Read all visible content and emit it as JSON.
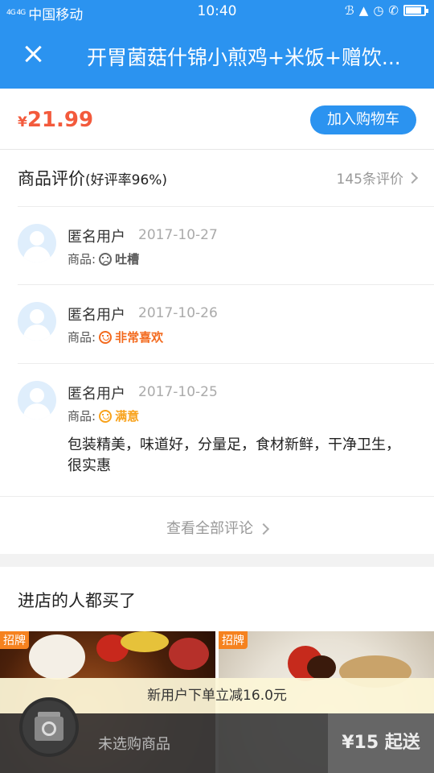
{
  "status_bar": {
    "signal": "4G 4G",
    "carrier": "中国移动",
    "time": "10:40",
    "battery_level": 0.85
  },
  "header": {
    "title": "开胃菌菇什锦小煎鸡+米饭+赠饮..."
  },
  "product": {
    "currency": "¥",
    "price": "21.99",
    "add_cart_label": "加入购物车"
  },
  "reviews": {
    "title": "商品评价",
    "rate": "(好评率96%)",
    "count": "145条评价",
    "items": [
      {
        "name": "匿名用户",
        "date": "2017-10-27",
        "goods_label": "商品:",
        "sentiment": "吐槽",
        "text": ""
      },
      {
        "name": "匿名用户",
        "date": "2017-10-26",
        "goods_label": "商品:",
        "sentiment": "非常喜欢",
        "text": ""
      },
      {
        "name": "匿名用户",
        "date": "2017-10-25",
        "goods_label": "商品:",
        "sentiment": "满意",
        "text": "包装精美，味道好，分量足，食材新鲜，干净卫生，很实惠"
      }
    ],
    "view_all": "查看全部评论"
  },
  "store": {
    "title": "进店的人都买了",
    "products": [
      {
        "tag": "招牌"
      },
      {
        "tag": "招牌"
      }
    ]
  },
  "promo": "新用户下单立减16.0元",
  "bottom_bar": {
    "cart_status": "未选购商品",
    "min_order": "¥15 起送"
  },
  "colors": {
    "primary": "#2b93f0",
    "price": "#f35a3c",
    "love": "#f36a1e",
    "ok": "#f8a21b",
    "tag": "#f5821f"
  }
}
